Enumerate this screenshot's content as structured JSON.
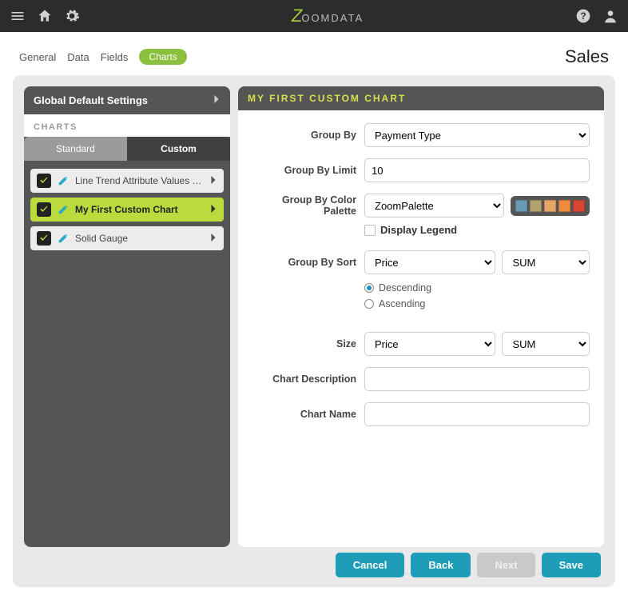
{
  "brand": {
    "z": "Z",
    "rest": "OOMDATA"
  },
  "breadcrumbs": {
    "general": "General",
    "data": "Data",
    "fields": "Fields",
    "charts": "Charts",
    "page_title": "Sales"
  },
  "sidebar": {
    "header": "Global Default Settings",
    "section": "CHARTS",
    "tabs": {
      "standard": "Standard",
      "custom": "Custom"
    },
    "items": [
      {
        "label": "Line Trend Attribute Values - Se…"
      },
      {
        "label": "My First Custom Chart"
      },
      {
        "label": "Solid Gauge"
      }
    ]
  },
  "form": {
    "title": "My First Custom Chart",
    "labels": {
      "group_by": "Group By",
      "group_by_limit": "Group By Limit",
      "group_by_palette": "Group By Color Palette",
      "display_legend": "Display Legend",
      "group_by_sort": "Group By Sort",
      "size": "Size",
      "chart_description": "Chart Description",
      "chart_name": "Chart Name"
    },
    "values": {
      "group_by": "Payment Type",
      "group_by_limit": "10",
      "palette_name": "ZoomPalette",
      "sort_field": "Price",
      "sort_agg": "SUM",
      "sort_dir_desc": "Descending",
      "sort_dir_asc": "Ascending",
      "size_field": "Price",
      "size_agg": "SUM",
      "chart_description": "",
      "chart_name": ""
    },
    "palette": [
      "#6b9bb3",
      "#b0a36b",
      "#e6a668",
      "#f08a3c",
      "#d64632"
    ]
  },
  "footer": {
    "cancel": "Cancel",
    "back": "Back",
    "next": "Next",
    "save": "Save"
  }
}
